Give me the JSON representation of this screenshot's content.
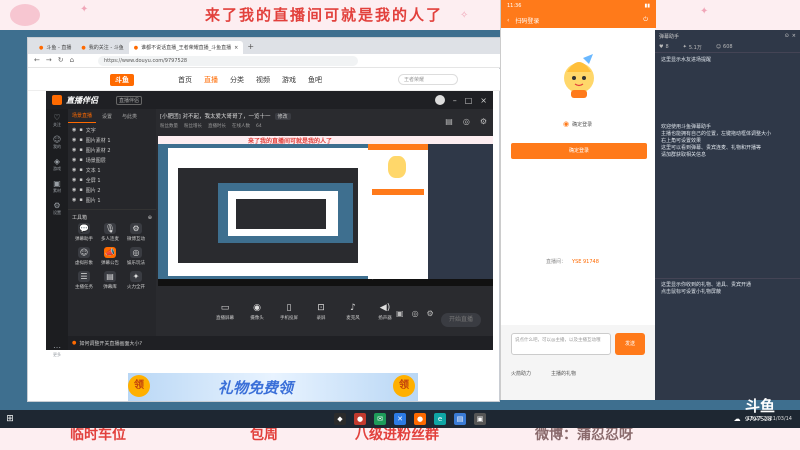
{
  "overlay": {
    "top_slogan": "来了我的直播间可就是我的人了",
    "bottom_items": [
      "临时车位",
      "包周",
      "八级进粉丝群",
      "微博：蒲忍忍呀"
    ]
  },
  "browser": {
    "tabs": [
      "斗鱼 - 直播",
      "我的关注 - 斗鱼",
      "谁都不说话直播_王者荣耀直播_斗鱼直播"
    ],
    "url": "https://www.douyu.com/9797528",
    "nav": {
      "logo": "斗鱼",
      "items": [
        "首页",
        "直播",
        "分类",
        "视频",
        "游戏",
        "鱼吧"
      ]
    },
    "search_placeholder": "王者荣耀",
    "banner_text": "礼物免费领",
    "banner_badge": "领"
  },
  "app": {
    "name": "直播伴侣",
    "version": "直播伴侣",
    "title_text": "[小肥团] 对不起，我太爱大哥哥了，一览十一",
    "tag": "修改",
    "sub_info": [
      "粉丝数量",
      "粉丝增长",
      "直播时长",
      "在线人数",
      "64"
    ],
    "rail": [
      "关注",
      "我的",
      "游戏",
      "素材",
      "设置",
      "更多"
    ],
    "panel_tabs": [
      "场景直播",
      "设置",
      "与此类"
    ],
    "layers": [
      "文字",
      "图片素材 1",
      "图片素材 2",
      "场景图层",
      "文本 1",
      "全屏 1",
      "图片 2",
      "图片 1"
    ],
    "tools_header": "工具箱",
    "tools": [
      {
        "label": "弹幕助手",
        "icon": "💬"
      },
      {
        "label": "多人连麦",
        "icon": "🎙"
      },
      {
        "label": "微博互动",
        "icon": "⚙"
      },
      {
        "label": "虚拟形象",
        "icon": "☺"
      },
      {
        "label": "弹幕公告",
        "icon": "📣"
      },
      {
        "label": "娱乐玩法",
        "icon": "◎"
      },
      {
        "label": "主播任务",
        "icon": "☰"
      },
      {
        "label": "弹幕库",
        "icon": "▤"
      },
      {
        "label": "火力全开",
        "icon": "✦"
      }
    ],
    "bottom_tools": [
      "直播屏幕",
      "摄像头",
      "手机投屏",
      "录屏",
      "麦克风",
      "扬声器"
    ],
    "live_button": "开始直播",
    "status_text": "如何调整开关直播画面大小?"
  },
  "phone": {
    "status_time": "11:36",
    "header": "扫码登录",
    "check_label": "确定登录",
    "button": "确定登录",
    "info_label": "直播间：",
    "info_value": "YSE 91748",
    "chat_placeholder": "说点什么吧，可以@主播，以及主播互动哦",
    "send": "发送",
    "footer_items": [
      "火箭助力",
      "主播的礼物"
    ]
  },
  "rpanel": {
    "header": "弹幕助手",
    "stats": [
      "8",
      "5.1万",
      "608"
    ],
    "lines": [
      "这里显示水友进场提醒",
      "",
      "欢迎使用斗鱼弹幕助手",
      "主播也能拥有自己的位置，左键拖动框体调整大小",
      "右上角可设置效果",
      "这里可以看到弹幕、贵宾连麦、礼物和开播等",
      "请加群获取相关信息"
    ],
    "lines2": [
      "这里显示你收到的礼物、道具、贵宾开通",
      "点击鼠标可设置小礼物屏蔽"
    ]
  },
  "watermark": {
    "logo": "斗鱼",
    "room": "9797528"
  },
  "taskbar": {
    "time": "18:27",
    "date": "2021/03/14"
  },
  "colors": {
    "accent": "#ff6a00",
    "slogan": "#e2403c"
  }
}
